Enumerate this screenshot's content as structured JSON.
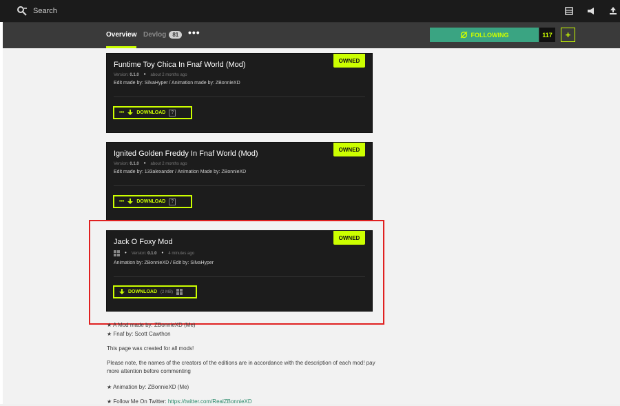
{
  "topbar": {
    "search_label": "Search"
  },
  "subnav": {
    "tabs": [
      {
        "label": "Overview"
      },
      {
        "label": "Devlog",
        "badge": "81"
      }
    ],
    "more_label": "•••",
    "follow_label": "FOLLOWING",
    "follow_count": "117",
    "plus_label": "+"
  },
  "uploads": [
    {
      "title": "Funtime Toy Chica In Fnaf World (Mod)",
      "version_label": "Version:",
      "version": "0.1.0",
      "time": "about 2 months ago",
      "credits": "Edit made by: SilvaHyper / Animation made by: ZBonnieXD",
      "owned_label": "OWNED",
      "button_label": "DOWNLOAD"
    },
    {
      "title": "Ignited Golden Freddy In Fnaf World (Mod)",
      "version_label": "Version:",
      "version": "0.1.0",
      "time": "about 2 months ago",
      "credits": "Edit made by: 133alexander / Animation Made by: ZBonnieXD",
      "owned_label": "OWNED",
      "button_label": "DOWNLOAD"
    },
    {
      "title": "Jack O Foxy Mod",
      "version_label": "Version:",
      "version": "0.1.0",
      "time": "4 minutes ago",
      "credits": "Animation by: ZBonnieXD / Edit by: SilvaHyper",
      "owned_label": "OWNED",
      "button_label": "DOWNLOAD",
      "file_size": "(2 MB)"
    }
  ],
  "description": {
    "line1": "★ A Mod made by: ZBonnieXD (Me)",
    "line2": "★ Fnaf by: Scott Cawthon",
    "line3": "This page was created for all mods!",
    "line4": "Please note, the names of the creators of the editions are in accordance with the description of each mod! pay more attention before commenting",
    "line5": "★ Animation by: ZBonnieXD (Me)",
    "line6_prefix": "★ Follow Me On Twitter:",
    "line6_link": "https://twitter.com/RealZBonnieXD"
  },
  "colors": {
    "accent": "#ccff00",
    "follow_bg": "#3aa482",
    "highlight": "#e02020",
    "card_bg": "#1c1c1c"
  }
}
